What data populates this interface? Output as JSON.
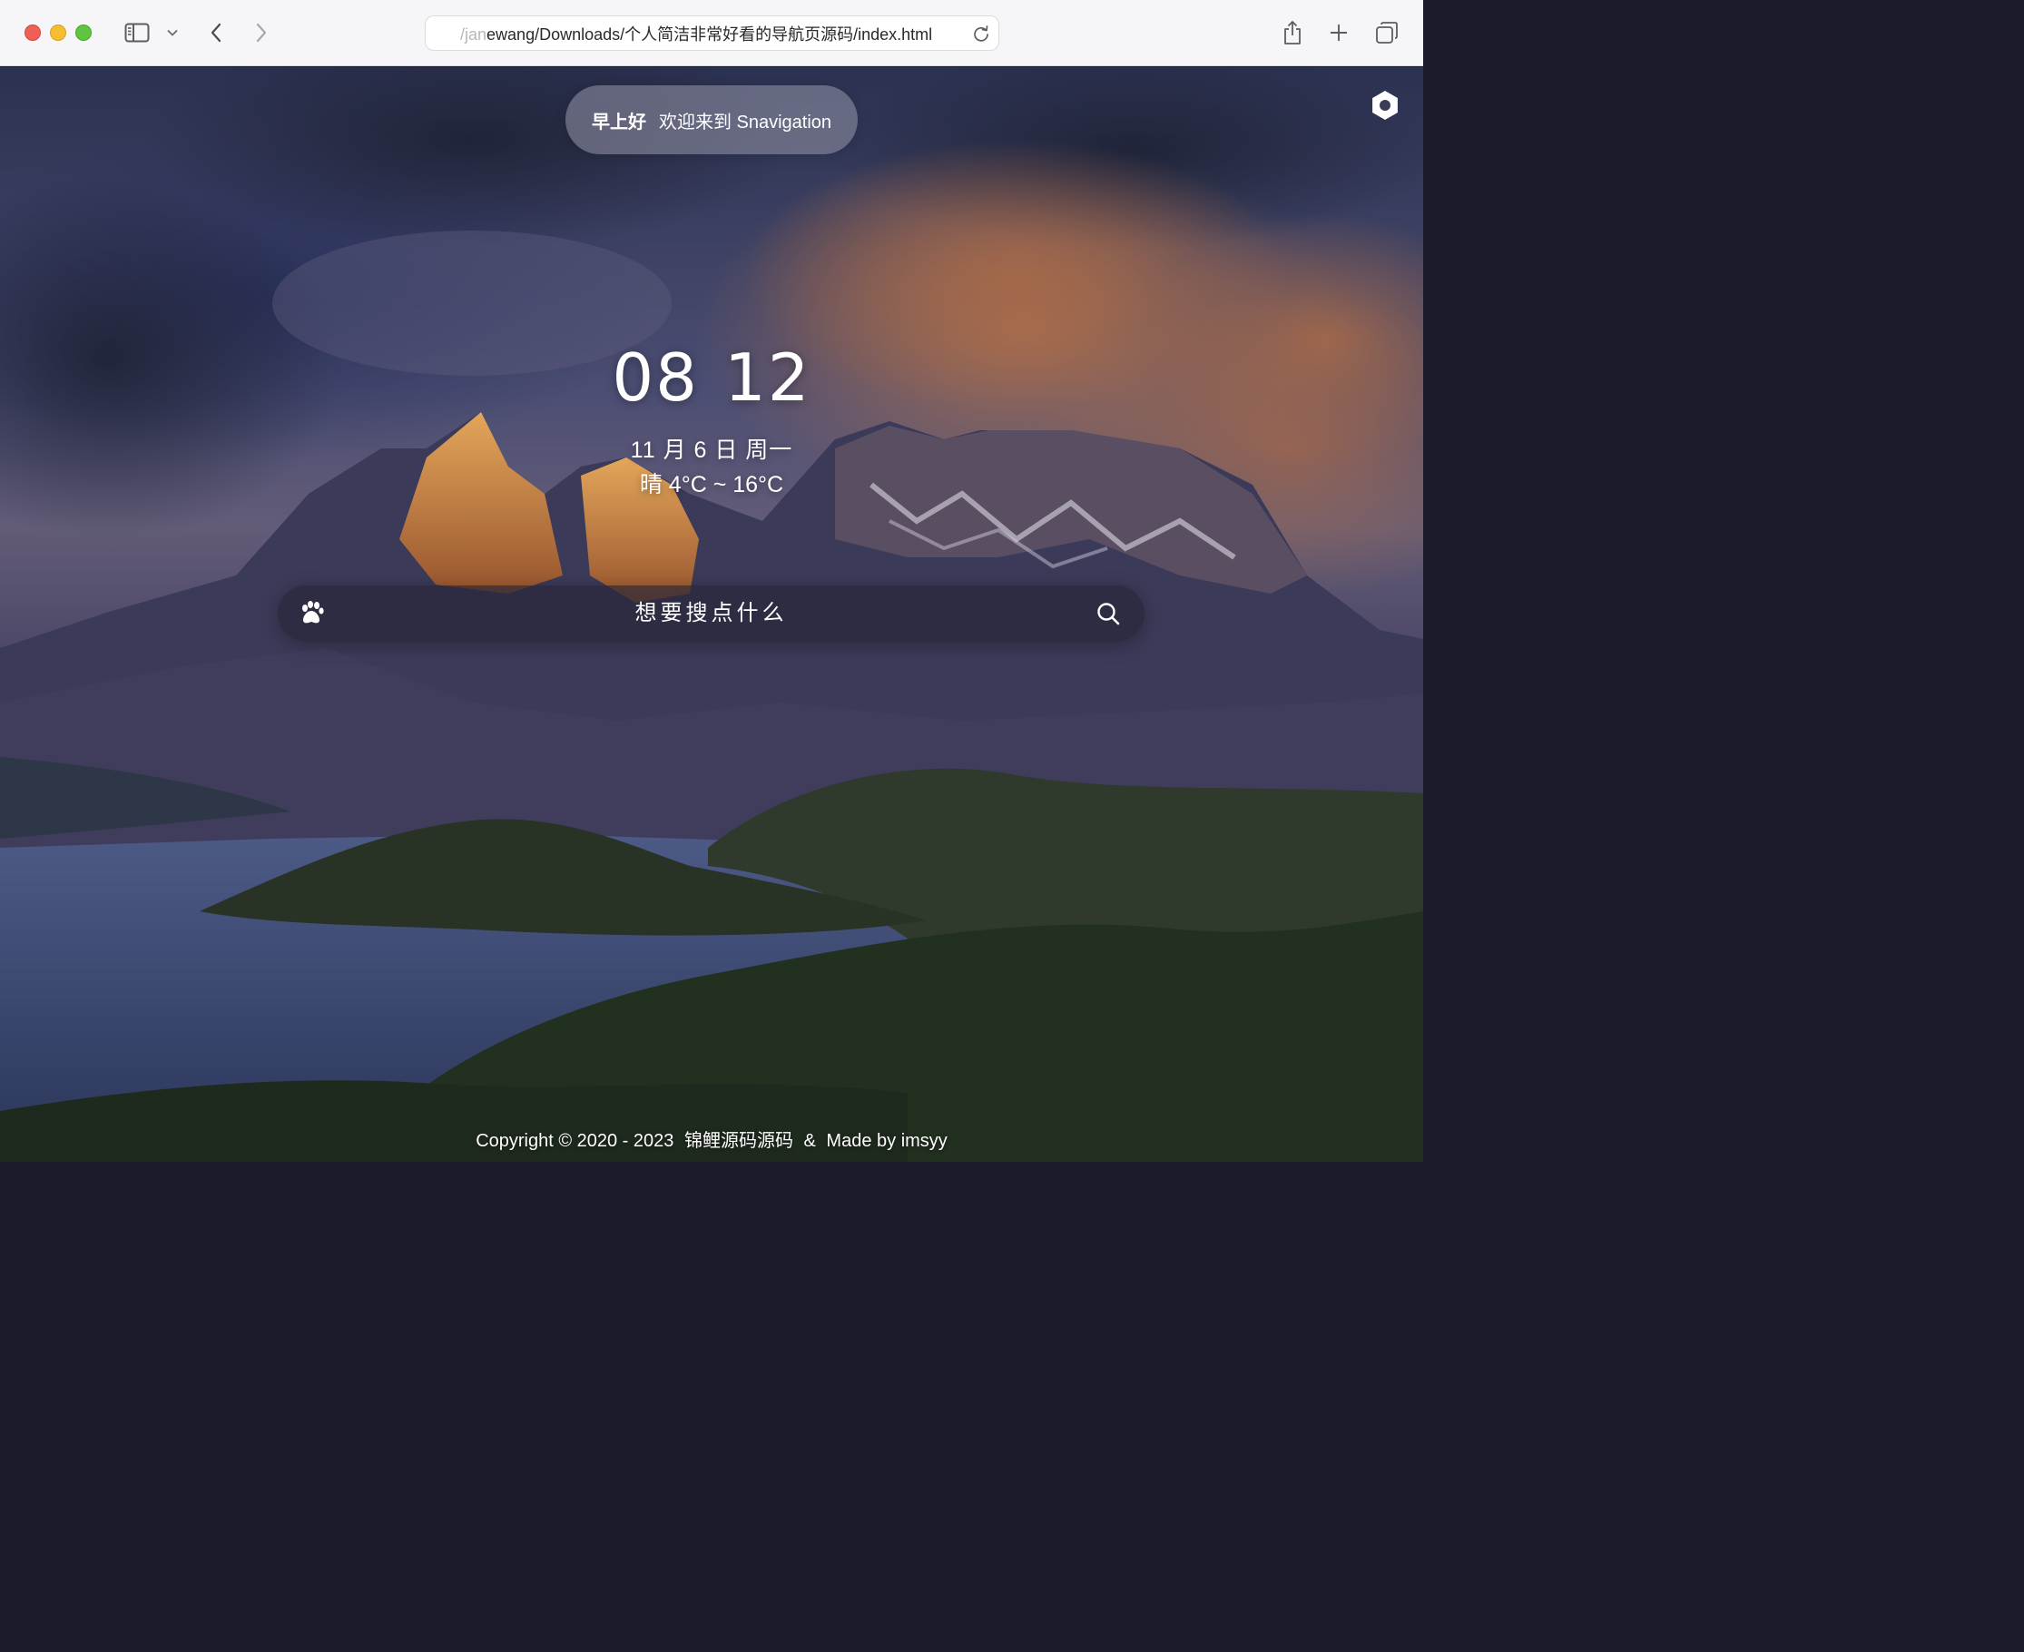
{
  "browser": {
    "url_faded": "/jan",
    "url_main": "ewang/Downloads/个人简洁非常好看的导航页源码/index.html",
    "icons": {
      "sidebar": "sidebar-icon",
      "tabs_dropdown": "chevron-down-icon",
      "back": "chevron-left-icon",
      "forward": "chevron-right-icon",
      "reload": "reload-icon",
      "share": "share-icon",
      "new_tab": "plus-icon",
      "tab_overview": "tabs-icon"
    },
    "colors": {
      "close": "#ee5f57",
      "minimize": "#f5bd2f",
      "zoom": "#5fc43f"
    }
  },
  "page": {
    "greeting": {
      "salutation": "早上好",
      "message": "欢迎来到 Snavigation"
    },
    "clock": {
      "hours": "08",
      "minutes": "12"
    },
    "date": "11 月 6 日 周一",
    "weather": "晴 4°C ~ 16°C",
    "search": {
      "placeholder": "想要搜点什么",
      "engine_icon": "paw-icon",
      "button_icon": "search-icon"
    },
    "settings_icon": "gear-icon",
    "footer": {
      "copyright": "Copyright © 2020 - 2023",
      "owner": "锦鲤源码源码",
      "separator": "&",
      "credit": "Made by imsyy"
    }
  }
}
